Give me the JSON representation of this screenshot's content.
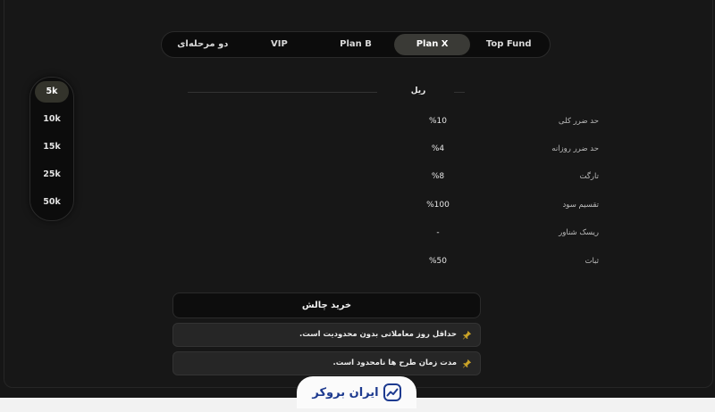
{
  "tabs": [
    {
      "label": "Top Fund",
      "active": false
    },
    {
      "label": "Plan X",
      "active": true
    },
    {
      "label": "Plan B",
      "active": false
    },
    {
      "label": "VIP",
      "active": false
    },
    {
      "label": "دو مرحله‌ای",
      "active": false
    }
  ],
  "sizes": [
    {
      "label": "5k",
      "active": true
    },
    {
      "label": "10k",
      "active": false
    },
    {
      "label": "15k",
      "active": false
    },
    {
      "label": "25k",
      "active": false
    },
    {
      "label": "50k",
      "active": false
    }
  ],
  "currency": "ریل",
  "rules": [
    {
      "label": "حد ضرر کلی",
      "value": "%10"
    },
    {
      "label": "حد ضرر روزانه",
      "value": "%4"
    },
    {
      "label": "تارگت",
      "value": "%8"
    },
    {
      "label": "تقسیم سود",
      "value": "%100"
    },
    {
      "label": "ریسک شناور",
      "value": "-"
    },
    {
      "label": "ثبات",
      "value": "%50"
    }
  ],
  "buy_label": "خرید چالش",
  "notes": [
    {
      "text": "حداقل روز معاملاتی بدون محدودیت است."
    },
    {
      "text": "مدت زمان طرح ها نامحدود است."
    }
  ],
  "logo": {
    "text": "ایران بروکر",
    "icon": "trend-chart-icon",
    "color": "#1d3a8f"
  },
  "colors": {
    "background": "#161616",
    "active_tab": "#3a3a36",
    "pin": "#c9a227"
  }
}
